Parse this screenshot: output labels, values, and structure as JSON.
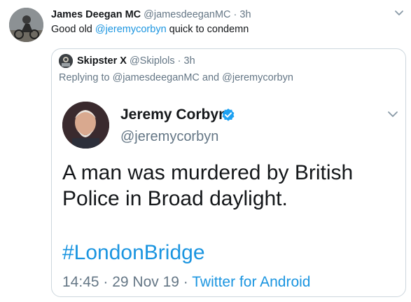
{
  "tweet": {
    "author_name": "James Deegan MC",
    "author_handle": "@jamesdeeganMC",
    "separator": "·",
    "time": "3h",
    "text_before": "Good old ",
    "mention": "@jeremycorbyn",
    "text_after": " quick to condemn"
  },
  "quote": {
    "author_name": "Skipster X",
    "author_handle": "@Skiplols",
    "separator": "·",
    "time": "3h",
    "replying_to": "Replying to @jamesdeeganMC and @jeremycorbyn"
  },
  "embedded_tweet": {
    "author_name": "Jeremy Corbyn",
    "author_handle": "@jeremycorbyn",
    "text_line1": "A man was murdered by British",
    "text_line2": "Police in Broad daylight.",
    "hashtag": "#LondonBridge",
    "timestamp": "14:45 · 29 Nov 19 ·",
    "source": "Twitter for Android"
  },
  "icons": {
    "caret": "chevron-down-icon",
    "verified": "verified-badge-icon"
  },
  "colors": {
    "link": "#1b95e0",
    "muted": "#657786",
    "verified": "#1da1f2",
    "border": "#ccd6dd"
  }
}
